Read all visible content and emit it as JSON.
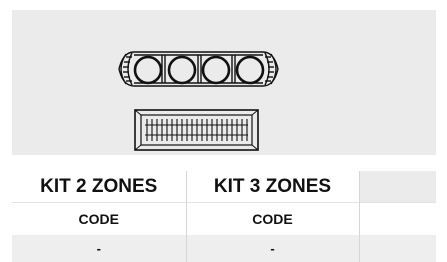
{
  "table": {
    "headers": [
      "KIT 2 ZONES",
      "KIT 3 ZONES",
      ""
    ],
    "code_row": [
      "CODE",
      "CODE",
      ""
    ],
    "value_row": [
      "-",
      "-",
      ""
    ]
  },
  "colors": {
    "panel_background": "#ebebeb",
    "line_art": "#111111",
    "value_row_background": "#eeeeee"
  }
}
